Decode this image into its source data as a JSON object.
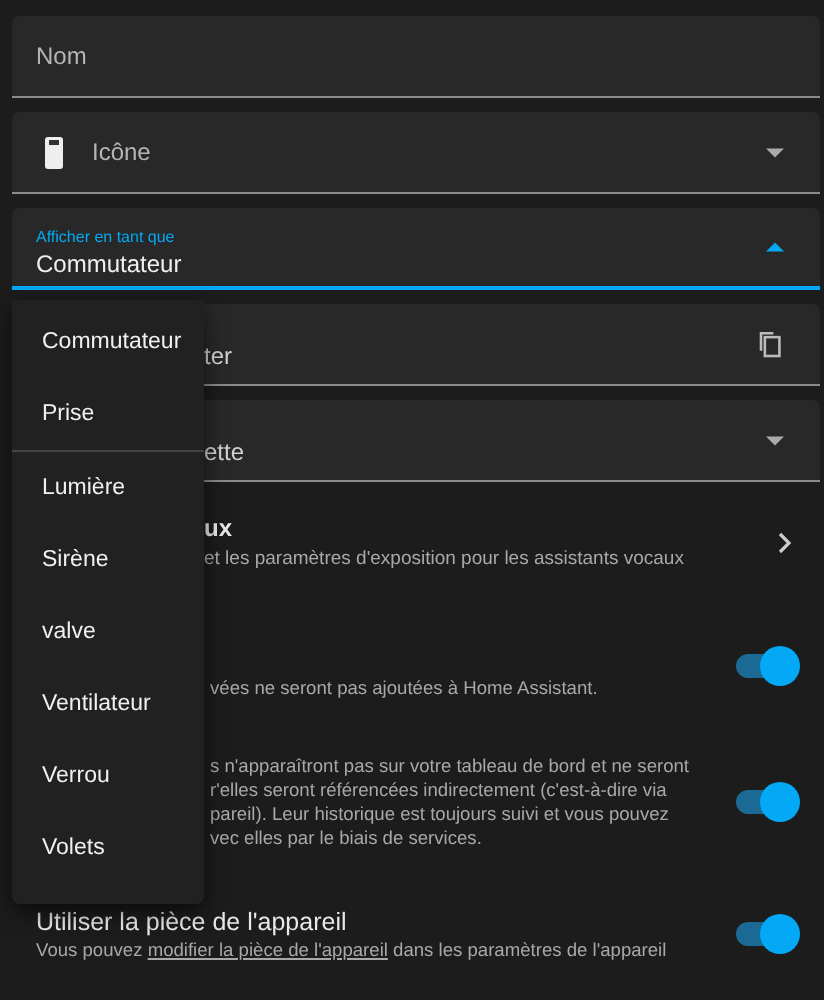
{
  "fields": [
    {
      "kind": "text",
      "label": "Nom"
    },
    {
      "kind": "icon-select",
      "label": "Icône"
    },
    {
      "kind": "select",
      "label": "Afficher en tant que",
      "value": "Commutateur",
      "focused": true
    },
    {
      "kind": "copy",
      "value": "ter"
    },
    {
      "kind": "dropdown",
      "value": "ette"
    }
  ],
  "nav_row": {
    "title": "ux",
    "description": "et les paramètres d'exposition pour les assistants vocaux"
  },
  "toggle_rows": [
    {
      "lines": [
        "vées ne seront pas ajoutées à Home Assistant."
      ],
      "on": true
    },
    {
      "lines": [
        "s n'apparaîtront pas sur votre tableau de bord et ne seront",
        "r'elles seront référencées indirectement (c'est-à-dire via",
        "pareil). Leur historique est toujours suivi et vous pouvez",
        "vec elles par le biais de services."
      ],
      "on": true
    },
    {
      "title": "Utiliser la pièce de l'appareil",
      "description_before": "Vous pouvez ",
      "link": "modifier la pièce de l'appareil",
      "description_after": " dans les paramètres de l'appareil",
      "on": true
    }
  ],
  "menu": {
    "groups": [
      [
        "Commutateur",
        "Prise"
      ],
      [
        "Lumière",
        "Sirène",
        "valve",
        "Ventilateur",
        "Verrou",
        "Volets"
      ]
    ]
  }
}
